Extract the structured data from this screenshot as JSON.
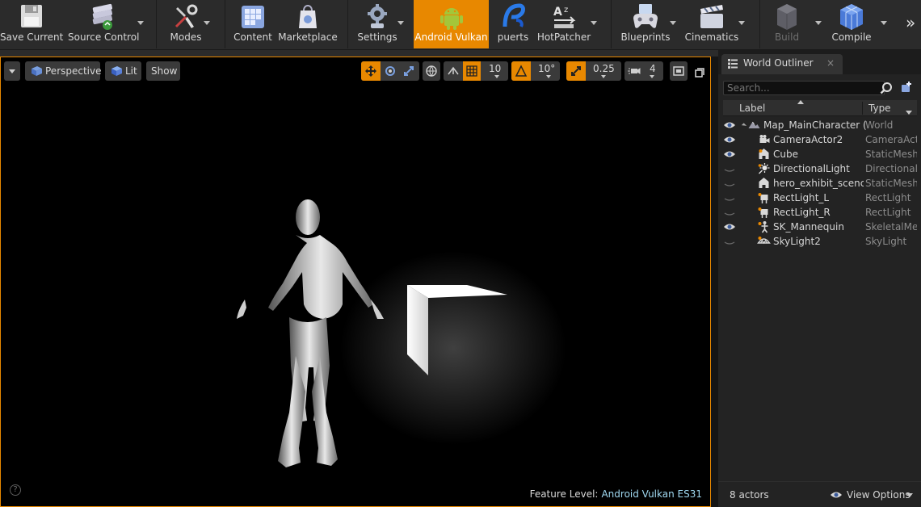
{
  "toolbar": {
    "save_current": "Save Current",
    "source_control": "Source Control",
    "modes": "Modes",
    "content": "Content",
    "marketplace": "Marketplace",
    "settings": "Settings",
    "android_vulkan": "Android Vulkan",
    "puerts": "puerts",
    "hotpatcher": "HotPatcher",
    "blueprints": "Blueprints",
    "cinematics": "Cinematics",
    "build": "Build",
    "compile": "Compile",
    "more": "»",
    "accent": "#e88800"
  },
  "viewport": {
    "perspective": "Perspective",
    "lit": "Lit",
    "show": "Show",
    "grid_snap": "10",
    "rotation_snap": "10°",
    "scale_snap": "0.25",
    "camera_speed": "4",
    "feature_level_label": "Feature Level:",
    "feature_level_value": "Android Vulkan ES31",
    "help": "?"
  },
  "outliner": {
    "tab_title": "World Outliner",
    "close": "×",
    "search_placeholder": "Search...",
    "col_label": "Label",
    "col_type": "Type",
    "rows": [
      {
        "name": "Map_MainCharacter (Editor)",
        "type": "World"
      },
      {
        "name": "CameraActor2",
        "type": "CameraActor"
      },
      {
        "name": "Cube",
        "type": "StaticMeshActor"
      },
      {
        "name": "DirectionalLight",
        "type": "DirectionalLight"
      },
      {
        "name": "hero_exhibit_scence",
        "type": "StaticMeshActor"
      },
      {
        "name": "RectLight_L",
        "type": "RectLight"
      },
      {
        "name": "RectLight_R",
        "type": "RectLight"
      },
      {
        "name": "SK_Mannequin",
        "type": "SkeletalMeshActor"
      },
      {
        "name": "SkyLight2",
        "type": "SkyLight"
      }
    ],
    "actor_count": "8 actors",
    "view_options": "View Options"
  }
}
